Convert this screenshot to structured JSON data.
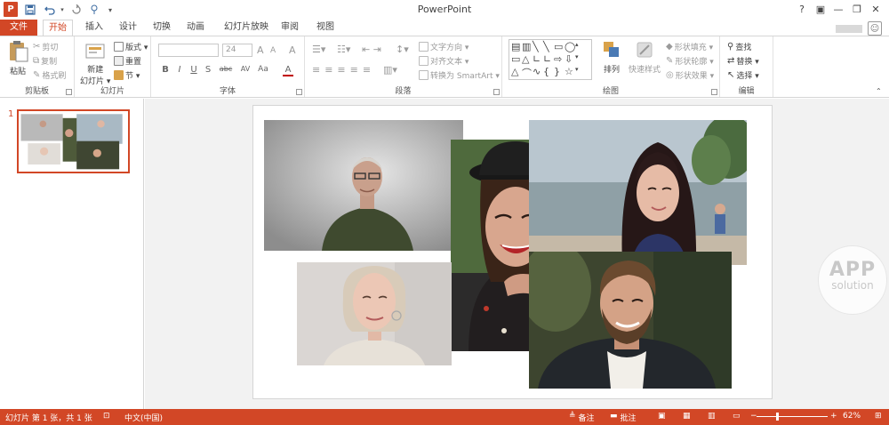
{
  "quick_access": {
    "logo": "P",
    "save_icon": "save-icon",
    "undo_icon": "undo-icon",
    "redo_icon": "redo-icon",
    "touch_icon": "touch-mode-icon",
    "customize_icon": "chevron-down-icon"
  },
  "window": {
    "title": "PowerPoint",
    "help": "?",
    "ribbon_display": "▣",
    "minimize": "—",
    "restore": "❐",
    "close": "✕"
  },
  "tabs": [
    {
      "label": "文件"
    },
    {
      "label": "开始"
    },
    {
      "label": "插入"
    },
    {
      "label": "设计"
    },
    {
      "label": "切换"
    },
    {
      "label": "动画"
    },
    {
      "label": "幻灯片放映"
    },
    {
      "label": "审阅"
    },
    {
      "label": "视图"
    }
  ],
  "ribbon": {
    "clipboard": {
      "label": "剪贴板",
      "paste": "粘贴",
      "cut": "剪切",
      "copy": "复制",
      "format_painter": "格式刷"
    },
    "slides": {
      "label": "幻灯片",
      "new_slide_line1": "新建",
      "new_slide_line2": "幻灯片 ▾",
      "layout": "版式 ▾",
      "reset": "重置",
      "section": "节 ▾"
    },
    "font": {
      "label": "字体",
      "font_name": "",
      "font_size": "24",
      "grow": "A",
      "shrink": "A",
      "clear": "A",
      "bold": "B",
      "italic": "I",
      "underline": "U",
      "strike": "S",
      "shadow": "abc",
      "spacing": "AV",
      "case": "Aa",
      "color": "A"
    },
    "paragraph": {
      "label": "段落",
      "text_direction": "文字方向 ▾",
      "align_text": "对齐文本 ▾",
      "smartart": "转换为 SmartArt ▾"
    },
    "drawing": {
      "label": "绘图",
      "arrange": "排列",
      "quick_styles": "快速样式",
      "shape_fill": "形状填充 ▾",
      "shape_outline": "形状轮廓 ▾",
      "shape_effects": "形状效果 ▾"
    },
    "editing": {
      "label": "编辑",
      "find": "查找",
      "replace": "替换 ▾",
      "select": "选择 ▾"
    }
  },
  "thumbnails": [
    {
      "number": "1"
    }
  ],
  "watermark": {
    "line1": "APP",
    "line2": "solution"
  },
  "status": {
    "slide_info": "幻灯片 第 1 张，共 1 张",
    "language": "中文(中国)",
    "notes": "备注",
    "comments": "批注",
    "zoom_percent": "62%",
    "zoom_value": 62,
    "zoom_minus": "−",
    "zoom_plus": "+"
  },
  "colors": {
    "accent": "#d24726",
    "ribbon_bg": "#ffffff",
    "workspace_bg": "#f2f2f2"
  }
}
